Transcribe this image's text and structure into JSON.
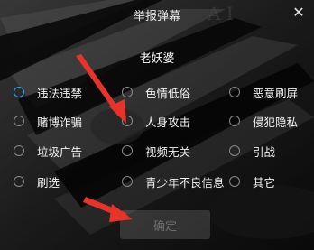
{
  "dialog": {
    "title": "举报弹幕",
    "close_glyph": "✕",
    "target_user": "老妖婆",
    "submit_label": "确定"
  },
  "options": [
    {
      "label": "违法违禁",
      "selected": true
    },
    {
      "label": "色情低俗",
      "selected": false
    },
    {
      "label": "恶意刷屏",
      "selected": false
    },
    {
      "label": "赌博诈骗",
      "selected": false
    },
    {
      "label": "人身攻击",
      "selected": false
    },
    {
      "label": "侵犯隐私",
      "selected": false
    },
    {
      "label": "垃圾广告",
      "selected": false
    },
    {
      "label": "视频无关",
      "selected": false
    },
    {
      "label": "引战",
      "selected": false
    },
    {
      "label": "刷选",
      "selected": false
    },
    {
      "label": "青少年不良信息",
      "selected": false
    },
    {
      "label": "其它",
      "selected": false
    }
  ],
  "colors": {
    "radio_selected": "#2ea6e8",
    "annotation_arrow": "#e8322a"
  }
}
